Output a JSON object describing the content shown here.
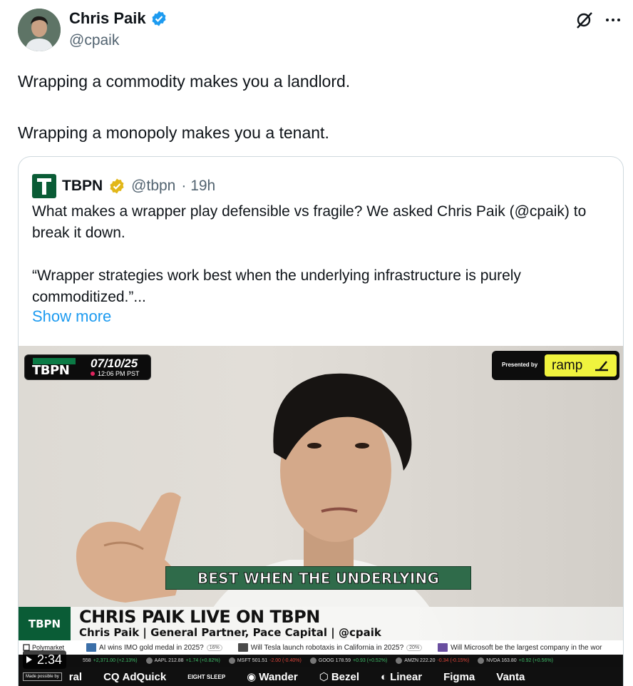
{
  "author": {
    "name": "Chris Paik",
    "handle": "@cpaik"
  },
  "tweet": {
    "paragraphs": [
      "Wrapping a commodity makes you a landlord.",
      "Wrapping a monopoly makes you a tenant."
    ]
  },
  "quote": {
    "name": "TBPN",
    "handle": "@tbpn",
    "time": "· 19h",
    "paragraphs": [
      "What makes a wrapper play defensible vs fragile? We asked Chris Paik (@cpaik) to break it down.",
      "“Wrapper strategies work best when the underlying infrastructure is purely commoditized.”..."
    ],
    "show_more": "Show more"
  },
  "video": {
    "logo": "TBPN",
    "date": "07/10/25",
    "time": "12:06 PM PST",
    "presented_by": "Presented by",
    "sponsor": "ramp",
    "caption": "BEST WHEN THE UNDERLYING",
    "lower_third_logo": "TBPN",
    "lower_third_title": "CHRIS PAIK LIVE ON TBPN",
    "lower_third_sub": "Chris Paik | General Partner, Pace Capital | @cpaik",
    "polymarket": "Polymarket",
    "markets": [
      {
        "text": "AI wins IMO gold medal in 2025?",
        "pct": "16%"
      },
      {
        "text": "Will Tesla launch robotaxis in California in 2025?",
        "pct": "20%"
      },
      {
        "text": "Will Microsoft be the largest company in the wor"
      }
    ],
    "stocks": [
      {
        "label": "558",
        "change": "+2,371.00 (+2.13%)",
        "dir": "up"
      },
      {
        "label": "AAPL 212.88",
        "change": "+1.74 (+0.82%)",
        "dir": "up"
      },
      {
        "label": "MSFT 501.51",
        "change": "-2.00 (-0.40%)",
        "dir": "down"
      },
      {
        "label": "GOOG 178.59",
        "change": "+0.93 (+0.52%)",
        "dir": "up"
      },
      {
        "label": "AMZN 222.20",
        "change": "-0.34 (-0.15%)",
        "dir": "down"
      },
      {
        "label": "NVDA 163.80",
        "change": "+0.92 (+0.56%)",
        "dir": "up"
      }
    ],
    "made_possible": "Made possible by",
    "sponsors": [
      "ral",
      "AdQuick",
      "EIGHT SLEEP",
      "Wander",
      "Bezel",
      "Linear",
      "Figma",
      "Vanta"
    ],
    "duration": "2:34"
  }
}
